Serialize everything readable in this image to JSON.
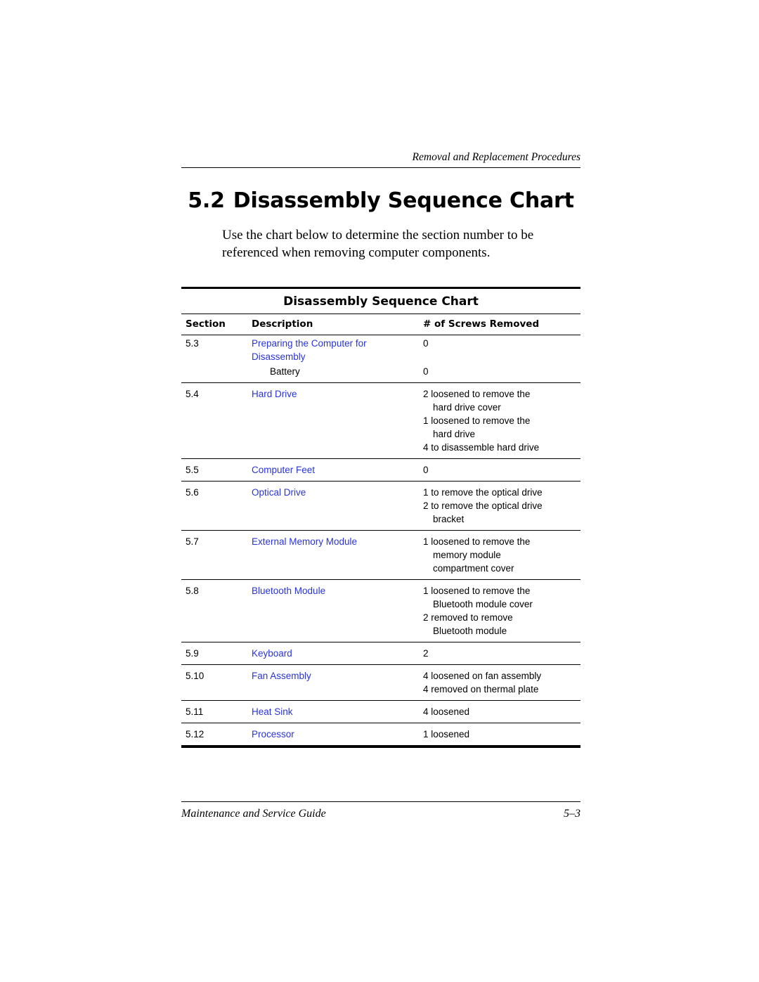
{
  "header": {
    "running_head": "Removal and Replacement Procedures"
  },
  "section": {
    "number": "5.2",
    "title": "Disassembly Sequence Chart",
    "intro": "Use the chart below to determine the section number to be referenced when removing computer components."
  },
  "table": {
    "caption": "Disassembly Sequence Chart",
    "columns": [
      "Section",
      "Description",
      "# of Screws Removed"
    ],
    "rows": [
      {
        "section": "5.3",
        "description": "Preparing the Computer for Disassembly",
        "is_link": true,
        "screws": "0",
        "sub": {
          "description": "Battery",
          "is_link": false,
          "screws": "0"
        }
      },
      {
        "section": "5.4",
        "description": "Hard Drive",
        "is_link": true,
        "screws_lines": [
          {
            "num": "2",
            "text": "loosened to remove the",
            "cont": "hard drive cover"
          },
          {
            "num": "1",
            "text": "loosened to remove the",
            "cont": "hard drive"
          },
          {
            "num": "4",
            "text": "to disassemble hard drive",
            "cont": ""
          }
        ]
      },
      {
        "section": "5.5",
        "description": "Computer Feet",
        "is_link": true,
        "screws": "0"
      },
      {
        "section": "5.6",
        "description": "Optical Drive",
        "is_link": true,
        "screws_lines": [
          {
            "num": "1",
            "text": "to remove the optical drive",
            "cont": ""
          },
          {
            "num": "2",
            "text": "to remove the optical drive",
            "cont": "bracket"
          }
        ]
      },
      {
        "section": "5.7",
        "description": "External Memory Module",
        "is_link": true,
        "screws_lines": [
          {
            "num": "1",
            "text": "loosened to remove the",
            "cont": "memory module\ncompartment cover"
          }
        ]
      },
      {
        "section": "5.8",
        "description": "Bluetooth Module",
        "is_link": true,
        "screws_lines": [
          {
            "num": "1",
            "text": "loosened to remove the",
            "cont": "Bluetooth module cover"
          },
          {
            "num": "2",
            "text": "removed to remove",
            "cont": "Bluetooth module"
          }
        ]
      },
      {
        "section": "5.9",
        "description": "Keyboard",
        "is_link": true,
        "screws": "2"
      },
      {
        "section": "5.10",
        "description": "Fan Assembly",
        "is_link": true,
        "screws_lines": [
          {
            "num": "4",
            "text": "loosened on fan assembly",
            "cont": ""
          },
          {
            "num": "4",
            "text": "removed on thermal plate",
            "cont": ""
          }
        ]
      },
      {
        "section": "5.11",
        "description": "Heat Sink",
        "is_link": true,
        "screws": "4 loosened"
      },
      {
        "section": "5.12",
        "description": "Processor",
        "is_link": true,
        "screws": "1 loosened"
      }
    ]
  },
  "footer": {
    "left": "Maintenance and Service Guide",
    "right": "5–3"
  },
  "colors": {
    "link": "#2a34d2",
    "text": "#000000"
  }
}
